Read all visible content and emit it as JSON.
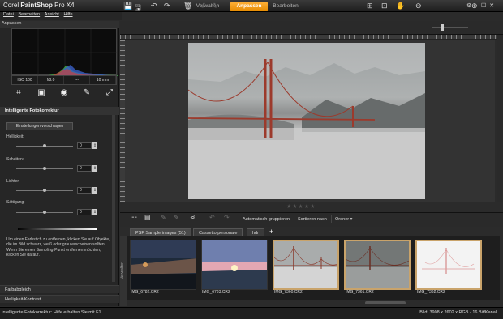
{
  "app": {
    "title_light": "Corel ",
    "title_bold": "PaintShop",
    "title_version": " Pro X4"
  },
  "mode_tabs": [
    "Verwalten",
    "Anpassen",
    "Bearbeiten"
  ],
  "window_controls": "⚙ ‒ ☐ ✕",
  "menu": [
    "Datei",
    "Bearbeiten",
    "Ansicht",
    "Hilfe"
  ],
  "panel": {
    "title": "Anpassen",
    "exif": [
      "ISO 100",
      "f/8.0",
      "---",
      "10 mm"
    ],
    "section_title": "Intelligente Fotokorrektur",
    "suggest_button": "Einstellungen vorschlagen",
    "sliders": [
      {
        "label": "Helligkeit:",
        "value": "0",
        "level": 0.5
      },
      {
        "label": "Schatten:",
        "value": "0",
        "level": 0.5
      },
      {
        "label": "Lichter:",
        "value": "0",
        "level": 0.5
      },
      {
        "label": "Sättigung:",
        "value": "0",
        "level": 0.5
      }
    ],
    "hint": "Um einen Farbstich zu entfernen, klicken Sie auf Objekte, die im Bild schwarz, weiß oder grau erscheinen sollten. Wenn Sie einen Sampling-Punkt entfernen möchten, klicken Sie darauf.",
    "collapsed_sections": [
      "Farbabgleich",
      "Helligkeit/Kontrast"
    ]
  },
  "toolbar_icons": [
    "save-icon",
    "save-as-icon",
    "rotate-left-icon",
    "rotate-right-icon",
    "delete-icon",
    "undo-icon",
    "redo-icon",
    "fit-icon",
    "actual-size-icon",
    "pan-icon",
    "zoom-out-icon",
    "zoom-in-icon"
  ],
  "rating": "★★★★★",
  "organizer": {
    "buttons": [
      "Automatisch gruppieren",
      "Sortieren nach",
      "Ordner ▾"
    ],
    "tabs": [
      "PSP Sample images (51)",
      "Cassetto personale",
      "hdr",
      "+"
    ],
    "side_tab": "Verwalter"
  },
  "thumbnails": [
    {
      "name": "IMG_6782.CR2",
      "selected": false
    },
    {
      "name": "IMG_6783.CR2",
      "selected": false
    },
    {
      "name": "IMG_7360.CR2",
      "selected": true
    },
    {
      "name": "IMG_7361.CR2",
      "selected": true
    },
    {
      "name": "IMG_7362.CR2",
      "selected": true
    }
  ],
  "status": {
    "left": "Intelligente Fotokorrektur: Hilfe erhalten Sie mit F1.",
    "right": "Bild: 3908 x 2602 x RGB - 16 Bit/Kanal"
  },
  "colors": {
    "accent": "#f09a10",
    "background": "#2b2b2b"
  }
}
